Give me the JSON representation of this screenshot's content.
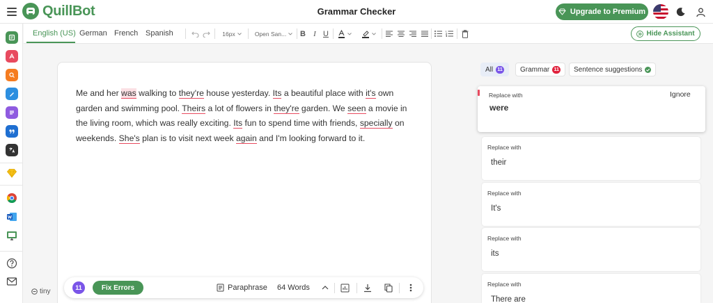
{
  "header": {
    "logo_text": "QuillBot",
    "page_title": "Grammar Checker",
    "premium_label": "Upgrade to Premium"
  },
  "toolbar": {
    "languages": [
      "English (US)",
      "German",
      "French",
      "Spanish"
    ],
    "font_size": "16px",
    "font_family": "Open San...",
    "hide_assistant_label": "Hide Assistant"
  },
  "editor": {
    "segments": [
      {
        "t": "Me and her "
      },
      {
        "t": "was",
        "e": 2
      },
      {
        "t": " walking to "
      },
      {
        "t": "they're",
        "e": 1
      },
      {
        "t": " house yesterday. "
      },
      {
        "t": "Its",
        "e": 1
      },
      {
        "t": " a beautiful place with "
      },
      {
        "t": "it's",
        "e": 1
      },
      {
        "t": " own garden and swimming pool. "
      },
      {
        "t": "Theirs",
        "e": 1
      },
      {
        "t": " a lot of flowers in "
      },
      {
        "t": "they're",
        "e": 1
      },
      {
        "t": " garden. We "
      },
      {
        "t": "seen",
        "e": 1
      },
      {
        "t": " a movie in the living room, which was really exciting. "
      },
      {
        "t": "Its",
        "e": 1
      },
      {
        "t": " fun to spend time with friends, "
      },
      {
        "t": "specially",
        "e": 1
      },
      {
        "t": " on weekends. "
      },
      {
        "t": "She's",
        "e": 1
      },
      {
        "t": " plan is to visit next week "
      },
      {
        "t": "again",
        "e": 1
      },
      {
        "t": " and I'm looking forward to it."
      }
    ],
    "error_count": "11",
    "fix_errors_label": "Fix Errors",
    "paraphrase_label": "Paraphrase",
    "word_count": "64 Words",
    "tiny_label": "tiny"
  },
  "assistant": {
    "filters": {
      "all_label": "All",
      "all_count": "11",
      "grammar_label": "Grammar",
      "grammar_count": "11",
      "sentence_label": "Sentence suggestions"
    },
    "ignore_label": "Ignore",
    "cards": [
      {
        "label": "Replace with",
        "value": "were"
      },
      {
        "label": "Replace with",
        "value": "their"
      },
      {
        "label": "Replace with",
        "value": "It's"
      },
      {
        "label": "Replace with",
        "value": "its"
      },
      {
        "label": "Replace with",
        "value": "There are"
      }
    ]
  },
  "colors": {
    "brand_green": "#499557",
    "error_red": "#e84a5f",
    "count_purple": "#7a55e8"
  }
}
